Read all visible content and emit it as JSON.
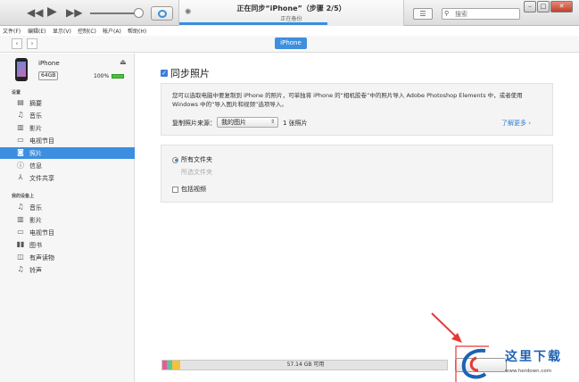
{
  "player": {
    "status_title": "正在同步“iPhone”（步骤 2/5）",
    "status_sub": "正在备份",
    "sync_progress": 0.66,
    "search_placeholder": "搜索"
  },
  "menu": [
    "文件(F)",
    "编辑(E)",
    "显示(V)",
    "控制(C)",
    "帐户(A)",
    "帮助(H)"
  ],
  "nav": {
    "device_tab": "iPhone"
  },
  "device": {
    "name": "iPhone",
    "capacity": "64GB",
    "battery": "100%"
  },
  "sidebar": {
    "settings_header": "设置",
    "settings_items": [
      {
        "label": "摘要",
        "icon": "summary-icon"
      },
      {
        "label": "音乐",
        "icon": "music-icon"
      },
      {
        "label": "影片",
        "icon": "movies-icon"
      },
      {
        "label": "电视节目",
        "icon": "tv-icon"
      },
      {
        "label": "照片",
        "icon": "photos-icon",
        "selected": true
      },
      {
        "label": "信息",
        "icon": "info-icon"
      },
      {
        "label": "文件共享",
        "icon": "file-sharing-icon"
      }
    ],
    "on_device_header": "我的设备上",
    "device_items": [
      {
        "label": "音乐",
        "icon": "music-icon"
      },
      {
        "label": "影片",
        "icon": "movies-icon"
      },
      {
        "label": "电视节目",
        "icon": "tv-icon"
      },
      {
        "label": "图书",
        "icon": "books-icon"
      },
      {
        "label": "有声读物",
        "icon": "audiobooks-icon"
      },
      {
        "label": "铃声",
        "icon": "ringtones-icon"
      }
    ]
  },
  "photos": {
    "sync_label": "同步照片",
    "description": "您可以选取电脑中要复制到 iPhone 的照片，可单独将 iPhone 的“相机胶卷”中的照片导入 Adobe Photoshop Elements 中，或者使用 Windows 中的“导入图片和视频”选项导入。",
    "source_label": "复制照片来源：",
    "source_value": "我的图片",
    "photo_count": "1 张照片",
    "learn_more": "了解更多",
    "options": [
      {
        "label": "所有文件夹",
        "type": "radio",
        "checked": true,
        "enabled": true
      },
      {
        "label": "所选文件夹",
        "type": "radio",
        "checked": false,
        "enabled": false
      },
      {
        "label": "包括视频",
        "type": "checkbox",
        "checked": false,
        "enabled": true
      }
    ]
  },
  "storage": {
    "free_label": "57.14 GB 可用"
  },
  "watermark": {
    "text": "这里下载",
    "url": "www.herdown.com"
  },
  "colors": {
    "accent": "#3b8ee0",
    "annotation": "#e53935",
    "watermark": "#1c62b5"
  }
}
